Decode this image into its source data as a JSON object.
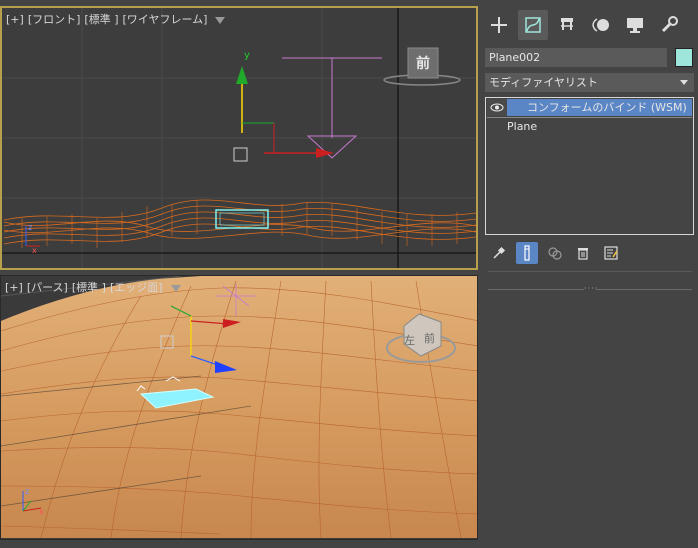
{
  "viewport_front": {
    "labels": [
      "[+]",
      "[フロント]",
      "[標準 ]",
      "[ワイヤフレーム]"
    ],
    "viewcube_label": "前"
  },
  "viewport_persp": {
    "labels": [
      "[+]",
      "[パース]",
      "[標準 ]",
      "[エッジ面]"
    ],
    "viewcube_labels": [
      "左",
      "前"
    ]
  },
  "panel": {
    "tabs": [
      "create-icon",
      "modify-icon",
      "hierarchy-icon",
      "motion-icon",
      "display-icon",
      "utilities-icon"
    ],
    "object_name": "Plane002",
    "object_color": "#9ee6dc",
    "modifier_list_label": "モディファイヤリスト",
    "stack": {
      "selected": "コンフォームのバインド (WSM)",
      "base": "Plane"
    },
    "stack_tools": [
      "pin-stack-icon",
      "show-end-result-icon",
      "make-unique-icon",
      "remove-modifier-icon",
      "configure-sets-icon"
    ]
  },
  "colors": {
    "active_viewport_border": "#b8a04a",
    "selection_blue": "#5b86c6",
    "wire_orange": "#d86a1e",
    "terrain": "#d9a66a"
  }
}
